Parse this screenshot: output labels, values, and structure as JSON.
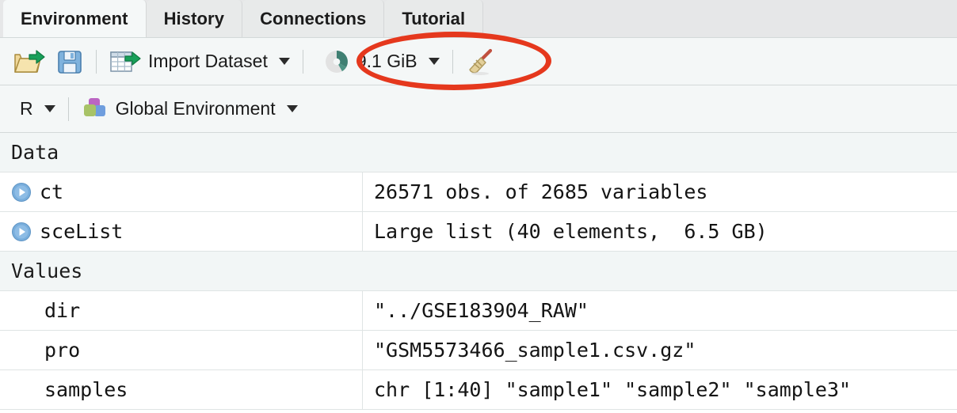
{
  "window": {
    "pane": "Environment pane"
  },
  "tabs": [
    {
      "label": "Environment",
      "active": true
    },
    {
      "label": "History",
      "active": false
    },
    {
      "label": "Connections",
      "active": false
    },
    {
      "label": "Tutorial",
      "active": false
    }
  ],
  "toolbar_primary": {
    "open_workspace": {
      "icon": "open-folder-icon",
      "tooltip": "Load workspace"
    },
    "save_workspace": {
      "icon": "save-disk-icon",
      "tooltip": "Save workspace"
    },
    "import_dataset": {
      "icon": "import-table-icon",
      "label": "Import Dataset",
      "caret": "▾"
    },
    "memory_usage": {
      "icon": "memory-pie-icon",
      "label": "9.1 GiB",
      "caret": "▾",
      "used_fraction": 0.42
    },
    "clear_objects": {
      "icon": "broom-icon",
      "tooltip": "Clear objects from the workspace"
    }
  },
  "toolbar_secondary": {
    "language": {
      "label": "R",
      "caret": "▾"
    },
    "environment_selector": {
      "icon": "environment-cubes-icon",
      "label": "Global Environment",
      "caret": "▾"
    }
  },
  "table": {
    "sections": [
      {
        "title": "Data",
        "rows": [
          {
            "name": "ct",
            "value": "26571 obs. of 2685 variables",
            "expandable": true
          },
          {
            "name": "sceList",
            "value": "Large list (40 elements,  6.5 GB)",
            "expandable": true
          }
        ]
      },
      {
        "title": "Values",
        "rows": [
          {
            "name": "dir",
            "value": "\"../GSE183904_RAW\"",
            "expandable": false
          },
          {
            "name": "pro",
            "value": "\"GSM5573466_sample1.csv.gz\"",
            "expandable": false
          },
          {
            "name": "samples",
            "value": "chr [1:40] \"sample1\" \"sample2\" \"sample3\"",
            "expandable": false
          }
        ]
      }
    ]
  },
  "annotation": {
    "shape": "ellipse",
    "color": "#e5381d",
    "targets": "memory_usage"
  },
  "colors": {
    "tab_active_bg": "#f5f8f8",
    "tab_inactive_bg": "#e8eaea",
    "tabbar_bg": "#e6e7e8",
    "toolbar_bg": "#f4f7f7",
    "section_header_bg": "#f2f6f6",
    "row_border": "#dfe4e4",
    "memory_pie_fill": "#3f7f72",
    "memory_pie_track": "#e2e2e2",
    "expander_blue": "#79aedc",
    "annotation_red": "#e5381d"
  }
}
